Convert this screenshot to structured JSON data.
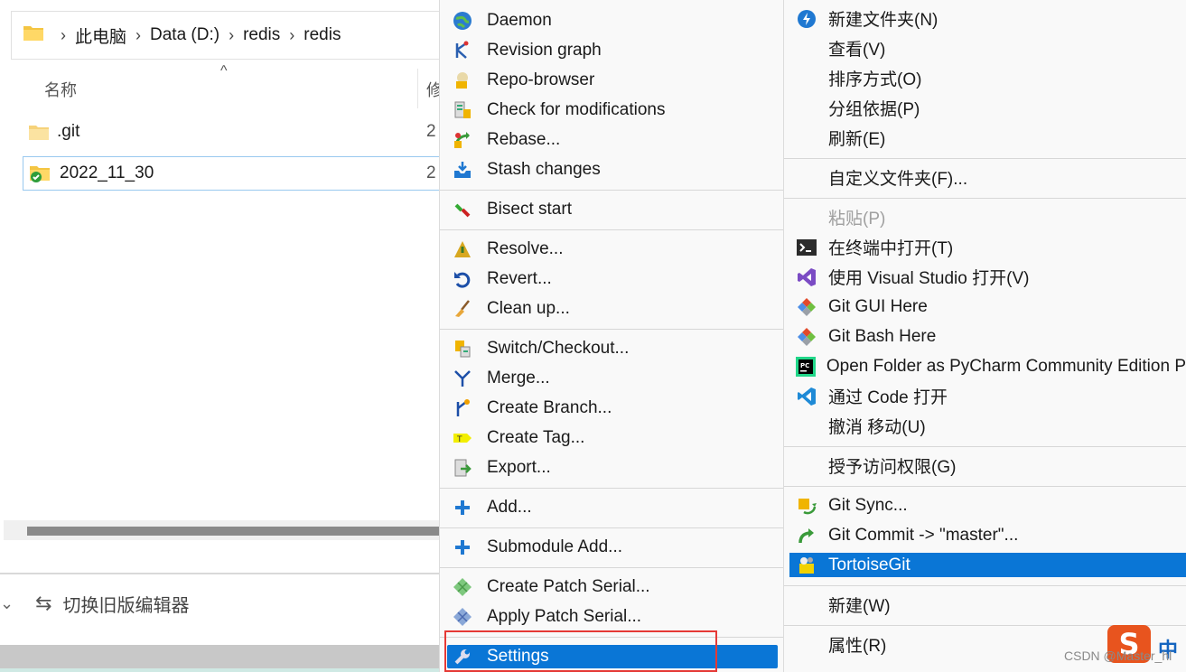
{
  "explorer": {
    "breadcrumb": [
      "此电脑",
      "Data (D:)",
      "redis",
      "redis"
    ],
    "column_name_label": "名称",
    "column_modified_label_cut": "修",
    "sort_indicator": "^",
    "files": [
      {
        "name": ".git",
        "date_cut": "2",
        "icon": "folder-icon"
      },
      {
        "name": "2022_11_30",
        "date_cut": "2",
        "icon": "folder-synced-icon",
        "selected": true
      }
    ],
    "legacy_editor_label": "切换旧版编辑器"
  },
  "tortoisegit_menu": {
    "items": [
      {
        "label": "Daemon",
        "icon": "globe-icon"
      },
      {
        "label": "Revision graph",
        "icon": "revision-graph-icon"
      },
      {
        "label": "Repo-browser",
        "icon": "repo-browser-icon"
      },
      {
        "label": "Check for modifications",
        "icon": "check-modifications-icon"
      },
      {
        "label": "Rebase...",
        "icon": "rebase-icon"
      },
      {
        "label": "Stash changes",
        "icon": "stash-icon"
      },
      {
        "label": "Bisect start",
        "icon": "bisect-icon"
      },
      {
        "label": "Resolve...",
        "icon": "resolve-icon"
      },
      {
        "label": "Revert...",
        "icon": "revert-icon"
      },
      {
        "label": "Clean up...",
        "icon": "broom-icon"
      },
      {
        "label": "Switch/Checkout...",
        "icon": "switch-icon"
      },
      {
        "label": "Merge...",
        "icon": "merge-icon"
      },
      {
        "label": "Create Branch...",
        "icon": "branch-icon"
      },
      {
        "label": "Create Tag...",
        "icon": "tag-icon"
      },
      {
        "label": "Export...",
        "icon": "export-icon"
      },
      {
        "label": "Add...",
        "icon": "plus-icon"
      },
      {
        "label": "Submodule Add...",
        "icon": "plus-icon"
      },
      {
        "label": "Create Patch Serial...",
        "icon": "patch-icon"
      },
      {
        "label": "Apply Patch Serial...",
        "icon": "apply-patch-icon"
      },
      {
        "label": "Settings",
        "icon": "wrench-icon",
        "highlighted": true
      }
    ]
  },
  "context_menu": {
    "items": [
      {
        "label": "新建文件夹(N)",
        "icon": "new-folder-icon"
      },
      {
        "label": "查看(V)"
      },
      {
        "label": "排序方式(O)"
      },
      {
        "label": "分组依据(P)"
      },
      {
        "label": "刷新(E)"
      },
      {
        "label": "自定义文件夹(F)..."
      },
      {
        "label": "粘贴(P)",
        "disabled": true
      },
      {
        "label": "在终端中打开(T)",
        "icon": "terminal-icon"
      },
      {
        "label": "使用 Visual Studio 打开(V)",
        "icon": "visual-studio-icon"
      },
      {
        "label": "Git GUI Here",
        "icon": "git-gui-icon"
      },
      {
        "label": "Git Bash Here",
        "icon": "git-bash-icon"
      },
      {
        "label": "Open Folder as PyCharm Community Edition P",
        "icon": "pycharm-icon"
      },
      {
        "label": "通过 Code 打开",
        "icon": "vscode-icon"
      },
      {
        "label": "撤消 移动(U)"
      },
      {
        "label": "授予访问权限(G)"
      },
      {
        "label": "Git Sync...",
        "icon": "git-sync-icon"
      },
      {
        "label": "Git Commit -> \"master\"...",
        "icon": "git-commit-icon"
      },
      {
        "label": "TortoiseGit",
        "icon": "tortoisegit-icon",
        "highlighted": true
      },
      {
        "label": "新建(W)"
      },
      {
        "label": "属性(R)"
      }
    ]
  },
  "overlay": {
    "ime_logo": "S",
    "ime_mode": "中",
    "watermark": "CSDN @Master_hl"
  },
  "colors": {
    "highlight": "#0a76d6",
    "menu_bg": "#f9f9f9",
    "annotation_red": "#e53935"
  }
}
